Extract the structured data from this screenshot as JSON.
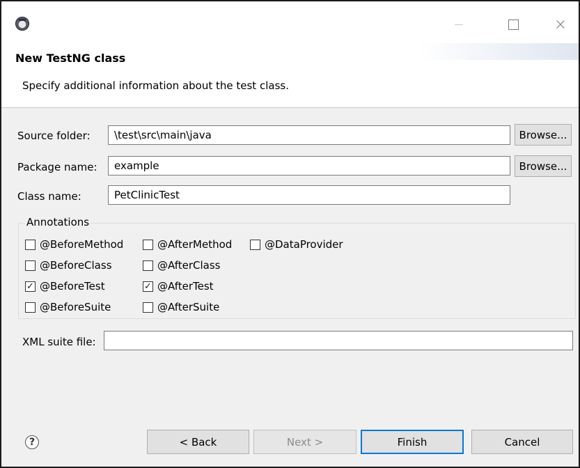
{
  "window": {
    "title": "",
    "icon": "eclipse-app-icon",
    "controls": {
      "minimize": "minimize-icon",
      "maximize": "maximize-icon",
      "close": "×"
    }
  },
  "banner": {
    "title": "New TestNG class",
    "description": "Specify additional information about the test class."
  },
  "form": {
    "source_folder": {
      "label": "Source folder:",
      "value": "\\test\\src\\main\\java",
      "browse": "Browse..."
    },
    "package_name": {
      "label": "Package name:",
      "value": "example",
      "browse": "Browse..."
    },
    "class_name": {
      "label": "Class name:",
      "value": "PetClinicTest"
    },
    "xml_suite": {
      "label": "XML suite file:",
      "value": ""
    }
  },
  "annotations": {
    "label": "Annotations",
    "items": [
      {
        "label": "@BeforeMethod",
        "checked": false
      },
      {
        "label": "@AfterMethod",
        "checked": false
      },
      {
        "label": "@DataProvider",
        "checked": false
      },
      {
        "label": "@BeforeClass",
        "checked": false
      },
      {
        "label": "@AfterClass",
        "checked": false
      },
      {
        "label": "@BeforeTest",
        "checked": true
      },
      {
        "label": "@AfterTest",
        "checked": true
      },
      {
        "label": "@BeforeSuite",
        "checked": false
      },
      {
        "label": "@AfterSuite",
        "checked": false
      }
    ]
  },
  "buttons": {
    "help": "?",
    "back": "< Back",
    "next": "Next >",
    "finish": "Finish",
    "cancel": "Cancel"
  },
  "colors": {
    "default_button_border": "#0078d7",
    "dialog_bg": "#f0f0f0"
  }
}
